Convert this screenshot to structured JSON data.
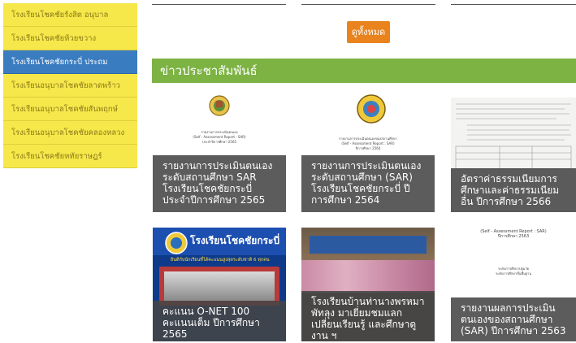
{
  "sidebar": {
    "items": [
      {
        "label": "โรงเรียนโชคชัยรังสิต อนุบาล",
        "active": false
      },
      {
        "label": "โรงเรียนโชคชัยห้วยขวาง",
        "active": false
      },
      {
        "label": "โรงเรียนโชคชัยกระบี่ ประถม",
        "active": true
      },
      {
        "label": "โรงเรียนอนุบาลโชคชัยลาดพร้าว",
        "active": false
      },
      {
        "label": "โรงเรียนอนุบาลโชคชัยสันพฤกษ์",
        "active": false
      },
      {
        "label": "โรงเรียนอนุบาลโชคชัยคลองหลวง",
        "active": false
      },
      {
        "label": "โรงเรียนโชคชัยหทัยราษฎร์",
        "active": false
      }
    ]
  },
  "buttons": {
    "view_all": "ดูทั้งหมด"
  },
  "news": {
    "heading": "ข่าวประชาสัมพันธ์",
    "cards": [
      {
        "caption": "รายงานการประเมินตนเอง ระดับสถานศึกษา SAR โรงเรียนโชคชัยกระบี่ ประจำปีการศึกษา 2565",
        "doc_lines": [
          "รายงานการประเมินตนเอง",
          "(Self - Assessment Report : SAR)",
          "ประจำปีการศึกษา 2565"
        ]
      },
      {
        "caption": "รายงานการประเมินตนเอง ระดับสถานศึกษา (SAR) โรงเรียนโชคชัยกระบี่ ปีการศึกษา 2564",
        "doc_lines": [
          "รายงานการประเมินตนเองของสถานศึกษา",
          "(Self - Assessment Report : SAR)",
          "ปีการศึกษา 2564"
        ]
      },
      {
        "caption": "อัตราค่าธรรมเนียมการศึกษาและค่าธรรมเนียมอื่น ปีการศึกษา 2566",
        "doc_lines": []
      },
      {
        "caption": "คะแนน O-NET 100 คะแนนเต็ม ปีการศึกษา 2565",
        "poster_title": "โรงเรียนโชคชัยกระบี่",
        "poster_sub": "ยินดีกับนักเรียนที่ได้คะแนนสูงสุดระดับชาติ 6 ทุกคน"
      },
      {
        "caption": "โรงเรียนบ้านท่านางพรหมา พัทลุง มาเยี่ยมชมแลกเปลี่ยนเรียนรู้ และศึกษาดูงาน ฯ",
        "doc_lines": []
      },
      {
        "caption": "รายงานผลการประเมินตนเองของสถานศึกษา (SAR) ปีการศึกษา 2563",
        "doc_lines": [
          "(Self - Assessment Report : SAR)",
          "ปีการศึกษา 2563",
          "ระดับการศึกษาปฐมวัย",
          "ระดับการศึกษาขั้นพื้นฐาน"
        ]
      }
    ]
  },
  "colors": {
    "sidebar_bg": "#f6e74a",
    "sidebar_active": "#3a7cc0",
    "button_orange": "#e8831e",
    "news_green": "#7cb343"
  }
}
